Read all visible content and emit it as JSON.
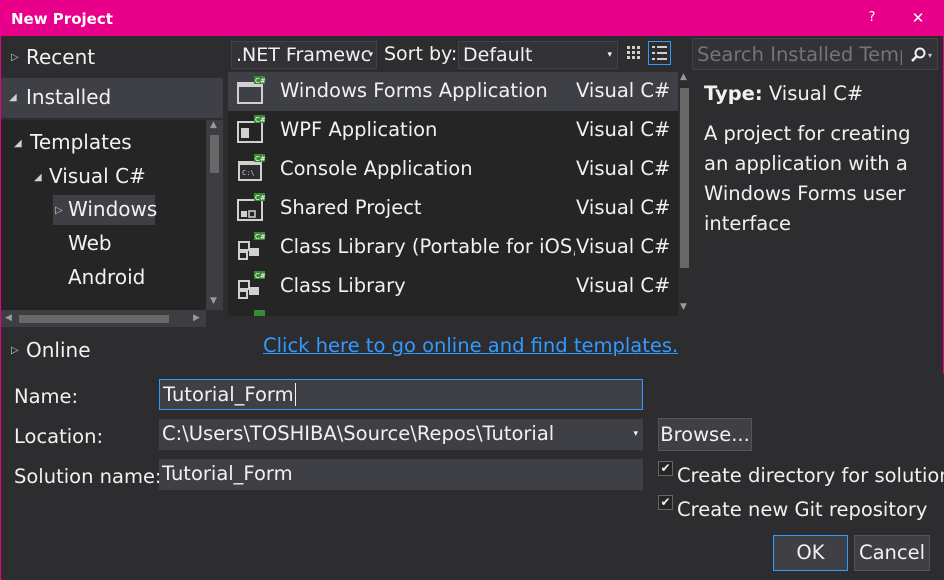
{
  "window": {
    "title": "New Project",
    "help_label": "?",
    "close_label": "✕"
  },
  "nav": {
    "recent_label": "Recent",
    "installed_label": "Installed",
    "templates_label": "Templates",
    "visual_csharp_label": "Visual C#",
    "tree_items": [
      "Windows",
      "Web",
      "Android"
    ],
    "online_label": "Online"
  },
  "toolbar": {
    "framework_value": ".NET Framewc",
    "sortby_label": "Sort by:",
    "sortby_value": "Default"
  },
  "templates": [
    {
      "name": "Windows Forms Application",
      "language": "Visual C#",
      "icon": "winforms-icon"
    },
    {
      "name": "WPF Application",
      "language": "Visual C#",
      "icon": "wpf-icon"
    },
    {
      "name": "Console Application",
      "language": "Visual C#",
      "icon": "console-icon"
    },
    {
      "name": "Shared Project",
      "language": "Visual C#",
      "icon": "shared-project-icon"
    },
    {
      "name": "Class Library (Portable for iOS,...",
      "language": "Visual C#",
      "icon": "class-library-icon"
    },
    {
      "name": "Class Library",
      "language": "Visual C#",
      "icon": "class-library-icon"
    }
  ],
  "search": {
    "placeholder": "Search Installed Templ"
  },
  "description": {
    "type_label": "Type:",
    "type_value": "Visual C#",
    "text": "A project for creating an application with a Windows Forms user interface"
  },
  "online_link": "Click here to go online and find templates.",
  "form": {
    "name_label": "Name:",
    "name_value": "Tutorial_Form",
    "location_label": "Location:",
    "location_value": "C:\\Users\\TOSHIBA\\Source\\Repos\\Tutorial",
    "solution_label": "Solution name:",
    "solution_value": "Tutorial_Form",
    "browse_label": "Browse...",
    "create_directory_label": "Create directory for solution",
    "create_directory_checked": true,
    "create_git_label": "Create new Git repository",
    "create_git_checked": true,
    "ok_label": "OK",
    "cancel_label": "Cancel"
  },
  "colors": {
    "accent": "#e8008a",
    "link": "#3399ff",
    "background": "#2d2d30",
    "selection": "#3f3f46"
  }
}
